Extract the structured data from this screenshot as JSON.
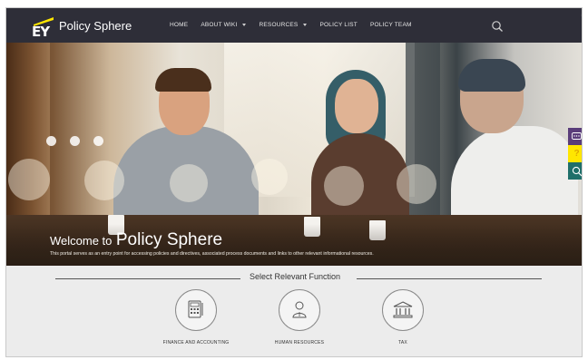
{
  "header": {
    "logo_text": "EY",
    "brand": "Policy Sphere",
    "nav": [
      {
        "label": "HOME",
        "has_dropdown": false
      },
      {
        "label": "ABOUT WIKI",
        "has_dropdown": true
      },
      {
        "label": "RESOURCES",
        "has_dropdown": true
      },
      {
        "label": "POLICY LIST",
        "has_dropdown": false
      },
      {
        "label": "POLICY TEAM",
        "has_dropdown": false
      }
    ],
    "search_icon": "search-icon",
    "settings_icon": "gear-icon"
  },
  "hero": {
    "welcome_prefix": "Welcome to",
    "welcome_name": "Policy Sphere",
    "description": "This portal serves as an entry point for accessing policies and directives, associated process documents and links to other relevant informational resources."
  },
  "side_tools": [
    {
      "name": "chat-icon",
      "color": "#5a3d7a"
    },
    {
      "name": "help-icon",
      "color": "#ffe600"
    },
    {
      "name": "search-icon",
      "color": "#1f6f6a"
    }
  ],
  "functions": {
    "title": "Select Relevant Function",
    "items": [
      {
        "label": "FINANCE AND ACCOUNTING",
        "icon": "calculator-icon"
      },
      {
        "label": "HUMAN RESOURCES",
        "icon": "person-icon"
      },
      {
        "label": "TAX",
        "icon": "building-icon"
      }
    ]
  },
  "colors": {
    "topbar": "#2e2e38",
    "ey_yellow": "#ffe600",
    "section_bg": "#ececec"
  }
}
